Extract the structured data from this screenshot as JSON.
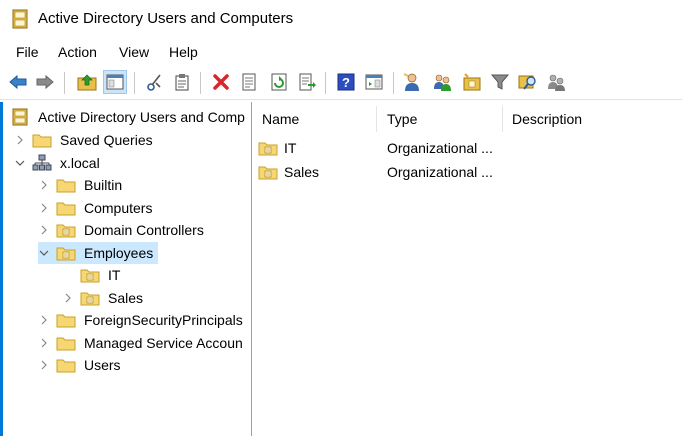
{
  "window": {
    "title": "Active Directory Users and Computers"
  },
  "menu": [
    "File",
    "Action",
    "View",
    "Help"
  ],
  "toolbar": [
    {
      "icon": "back-arrow-icon"
    },
    {
      "icon": "forward-arrow-icon"
    },
    {
      "icon": "up-folder-icon"
    },
    {
      "icon": "show-console-tree-icon"
    },
    {
      "icon": "cut-icon"
    },
    {
      "icon": "copy-icon"
    },
    {
      "icon": "delete-icon"
    },
    {
      "icon": "properties-icon"
    },
    {
      "icon": "refresh-icon"
    },
    {
      "icon": "export-list-icon"
    },
    {
      "icon": "help-icon"
    },
    {
      "icon": "show-action-pane-icon"
    },
    {
      "icon": "new-user-icon"
    },
    {
      "icon": "new-group-icon"
    },
    {
      "icon": "new-ou-icon"
    },
    {
      "icon": "filter-icon"
    },
    {
      "icon": "find-icon"
    },
    {
      "icon": "add-to-group-icon"
    }
  ],
  "tree": {
    "root": "Active Directory Users and Comp",
    "nodes": [
      {
        "label": "Saved Queries"
      },
      {
        "label": "x.local"
      },
      {
        "label": "Builtin"
      },
      {
        "label": "Computers"
      },
      {
        "label": "Domain Controllers"
      },
      {
        "label": "Employees"
      },
      {
        "label": "IT"
      },
      {
        "label": "Sales"
      },
      {
        "label": "ForeignSecurityPrincipals"
      },
      {
        "label": "Managed Service Accoun"
      },
      {
        "label": "Users"
      }
    ]
  },
  "list": {
    "columns": [
      "Name",
      "Type",
      "Description"
    ],
    "rows": [
      {
        "name": "IT",
        "type": "Organizational ...",
        "description": ""
      },
      {
        "name": "Sales",
        "type": "Organizational ...",
        "description": ""
      }
    ]
  }
}
